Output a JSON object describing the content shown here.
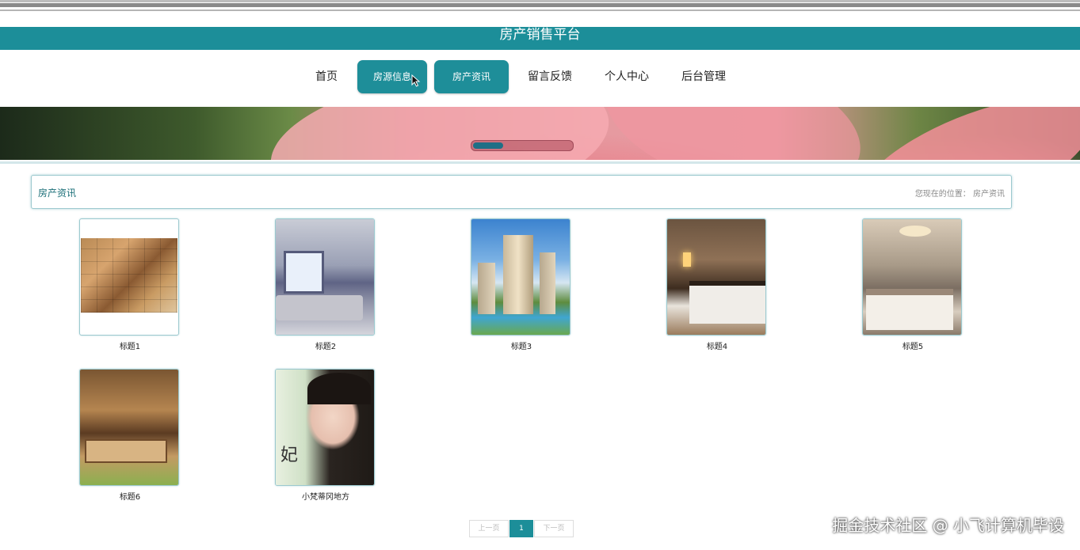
{
  "site": {
    "title": "房产销售平台"
  },
  "nav": {
    "items": [
      {
        "label": "首页"
      },
      {
        "label": "房源信息"
      },
      {
        "label": "房产资讯"
      },
      {
        "label": "留言反馈"
      },
      {
        "label": "个人中心"
      },
      {
        "label": "后台管理"
      }
    ]
  },
  "section": {
    "title": "房产资讯",
    "location": "您现在的位置： 房产资讯"
  },
  "news": [
    {
      "title": "标题1"
    },
    {
      "title": "标题2"
    },
    {
      "title": "标题3"
    },
    {
      "title": "标题4"
    },
    {
      "title": "标题5"
    },
    {
      "title": "标题6"
    },
    {
      "title": "小梵蒂冈地方"
    }
  ],
  "pagination": {
    "prev": "上一页",
    "current": "1",
    "next": "下一页"
  },
  "watermark": "掘金技术社区 @ 小飞计算机毕设",
  "colors": {
    "accent": "#1c8e99"
  }
}
